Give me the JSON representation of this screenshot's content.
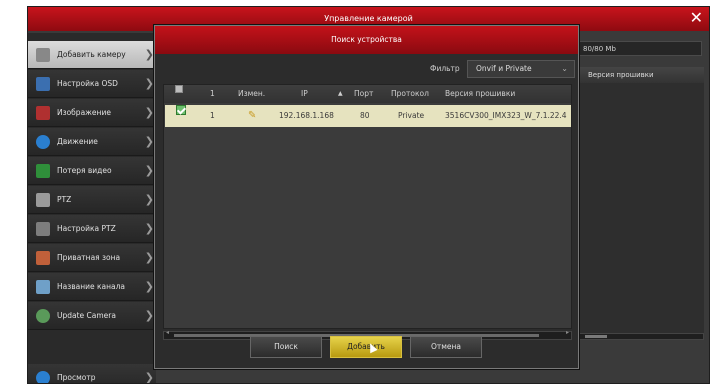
{
  "window": {
    "title": "Управление камерой"
  },
  "sidebar": {
    "items": [
      {
        "label": "Добавить камеру",
        "icon": "camera-add-icon",
        "active": true
      },
      {
        "label": "Настройка OSD",
        "icon": "osd-icon"
      },
      {
        "label": "Изображение",
        "icon": "image-icon"
      },
      {
        "label": "Движение",
        "icon": "motion-icon"
      },
      {
        "label": "Потеря видео",
        "icon": "video-loss-icon"
      },
      {
        "label": "PTZ",
        "icon": "ptz-camera-icon"
      },
      {
        "label": "Настройка PTZ",
        "icon": "ptz-settings-icon"
      },
      {
        "label": "Приватная зона",
        "icon": "privacy-zone-icon"
      },
      {
        "label": "Название канала",
        "icon": "channel-name-icon"
      },
      {
        "label": "Update Camera",
        "icon": "update-icon"
      }
    ],
    "bottom": {
      "label": "Просмотр",
      "icon": "preview-icon"
    }
  },
  "right_panel": {
    "capacity": "80/80 Mb",
    "header": "Версия прошивки"
  },
  "dialog": {
    "title": "Поиск устройства",
    "filter_label": "Фильтр",
    "filter_value": "Onvif и Private",
    "columns": [
      "",
      "1",
      "Измен.",
      "IP",
      "Порт",
      "Протокол",
      "Версия прошивки"
    ],
    "rows": [
      {
        "num": "1",
        "ip": "192.168.1.168",
        "port": "80",
        "protocol": "Private",
        "firmware": "3516CV300_IMX323_W_7.1.22.4"
      }
    ],
    "buttons": {
      "search": "Поиск",
      "add": "Добавить",
      "cancel": "Отмена"
    }
  },
  "colors": {
    "accent_red": "#b01018",
    "selected_row": "#e6e3bf",
    "primary_button": "#d4bc28"
  }
}
